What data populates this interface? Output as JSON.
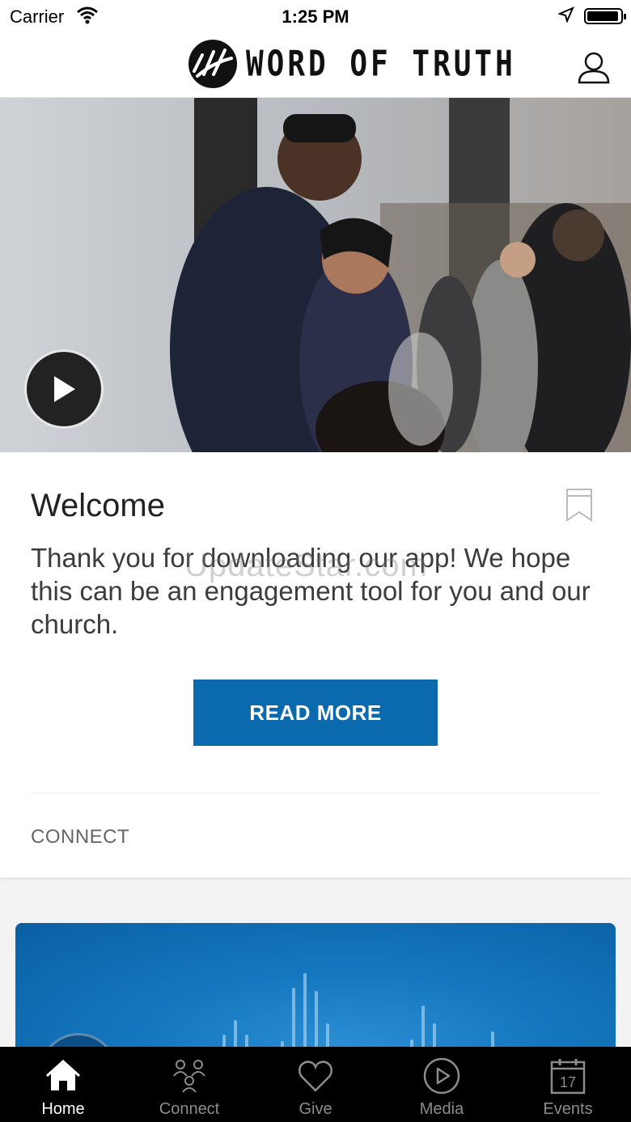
{
  "status_bar": {
    "carrier": "Carrier",
    "time": "1:25 PM"
  },
  "header": {
    "logo_text": "WORD OF TRUTH"
  },
  "card": {
    "title": "Welcome",
    "body": "Thank you for downloading our app! We hope this can be an engagement tool for you and our church.",
    "watermark": "UpdateStar.com",
    "button_label": "READ MORE",
    "section_label": "CONNECT"
  },
  "tabs": [
    {
      "label": "Home",
      "icon": "home-icon",
      "active": true
    },
    {
      "label": "Connect",
      "icon": "connect-icon",
      "active": false
    },
    {
      "label": "Give",
      "icon": "heart-icon",
      "active": false
    },
    {
      "label": "Media",
      "icon": "play-circle-icon",
      "active": false
    },
    {
      "label": "Events",
      "icon": "calendar-icon",
      "active": false,
      "calendar_day": "17"
    }
  ],
  "colors": {
    "accent": "#0a6aad",
    "tabbar": "#000000"
  }
}
